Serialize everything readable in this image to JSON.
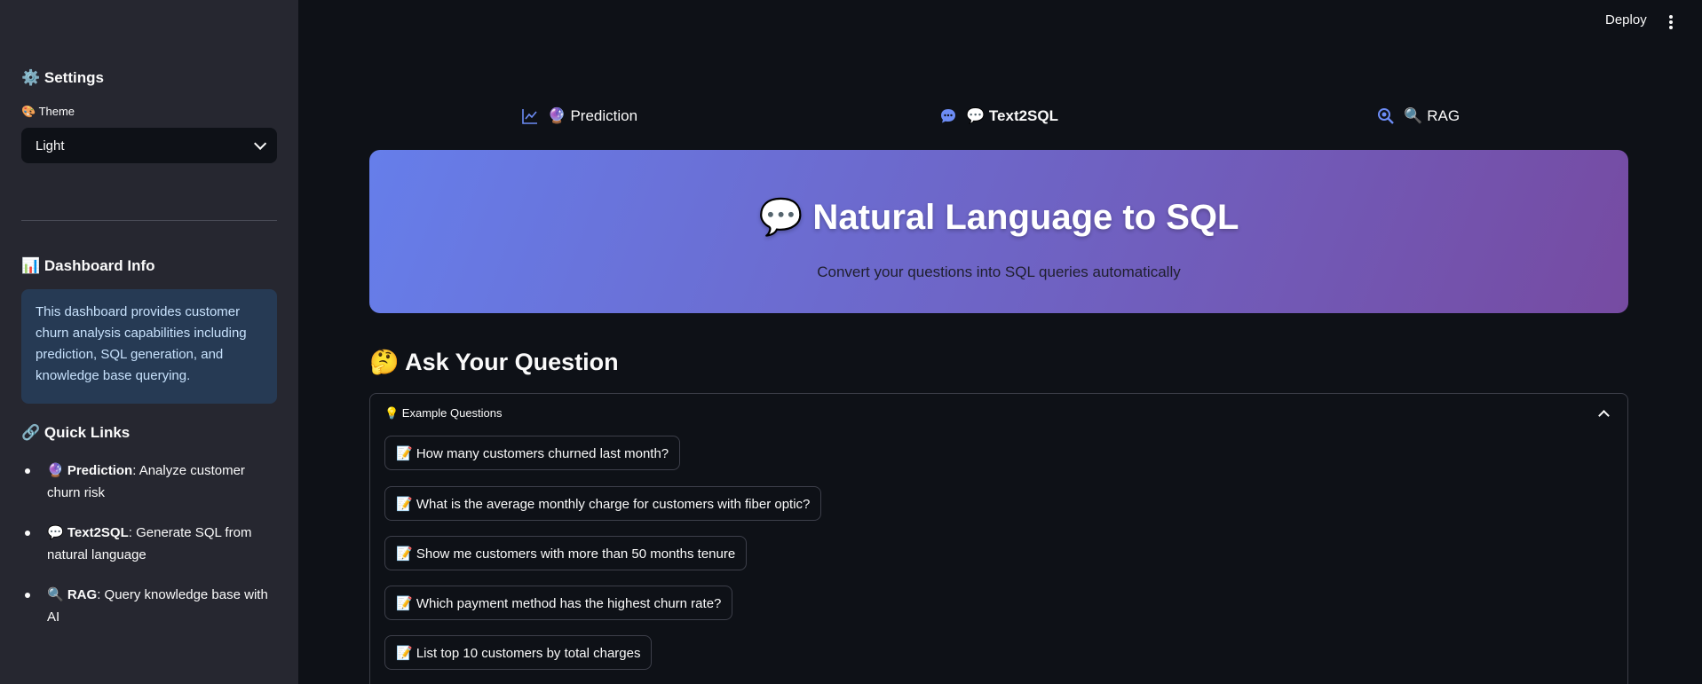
{
  "header": {
    "deploy_label": "Deploy"
  },
  "sidebar": {
    "settings_title": "⚙️ Settings",
    "theme_label": "🎨 Theme",
    "theme_value": "Light",
    "dashboard_title": "📊 Dashboard Info",
    "dashboard_info": "This dashboard provides customer churn analysis capabilities including prediction, SQL generation, and knowledge base querying.",
    "quick_links_title": "🔗 Quick Links",
    "links": [
      {
        "name": "🔮 Prediction",
        "desc": ": Analyze customer churn risk"
      },
      {
        "name": "💬 Text2SQL",
        "desc": ": Generate SQL from natural language"
      },
      {
        "name": "🔍 RAG",
        "desc": ": Query knowledge base with AI"
      }
    ]
  },
  "tabs": [
    {
      "label": "🔮 Prediction",
      "icon": "line-chart-icon"
    },
    {
      "label": "💬 Text2SQL",
      "icon": "chat-bubble-icon",
      "active": true
    },
    {
      "label": "🔍 RAG",
      "icon": "search-icon"
    }
  ],
  "banner": {
    "title": "💬 Natural Language to SQL",
    "subtitle": "Convert your questions into SQL queries automatically"
  },
  "ask": {
    "title": "🤔 Ask Your Question",
    "expander_label": "💡 Example Questions",
    "questions": [
      "📝 How many customers churned last month?",
      "📝 What is the average monthly charge for customers with fiber optic?",
      "📝 Show me customers with more than 50 months tenure",
      "📝 Which payment method has the highest churn rate?",
      "📝 List top 10 customers by total charges"
    ]
  },
  "colors": {
    "background": "#0e1117",
    "sidebar": "#262730",
    "accent": "#667eea",
    "banner_end": "#764ba2",
    "info_box": "#263a54"
  }
}
